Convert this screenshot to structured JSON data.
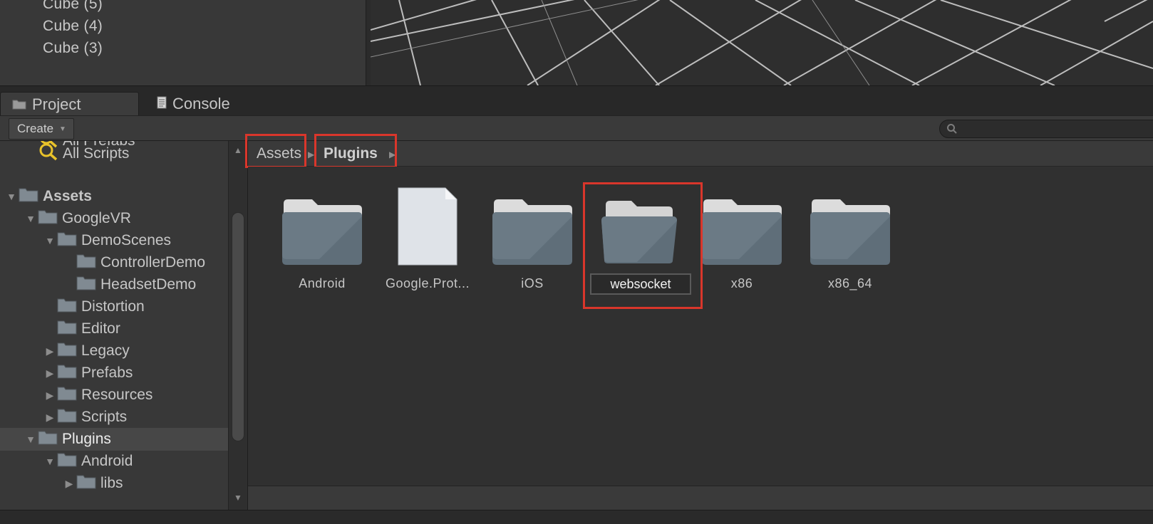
{
  "hierarchy": {
    "items": [
      "Cube (5)",
      "Cube (4)",
      "Cube (3)"
    ]
  },
  "tabs": {
    "project": "Project",
    "console": "Console"
  },
  "toolbar": {
    "create_label": "Create",
    "search_placeholder": ""
  },
  "tree": {
    "partial_item": "All Prefabs",
    "all_scripts": "All Scripts",
    "items": [
      {
        "label": "Assets",
        "expanded": true
      },
      {
        "label": "GoogleVR",
        "expanded": true
      },
      {
        "label": "DemoScenes",
        "expanded": true
      },
      {
        "label": "ControllerDemo"
      },
      {
        "label": "HeadsetDemo"
      },
      {
        "label": "Distortion"
      },
      {
        "label": "Editor"
      },
      {
        "label": "Legacy",
        "expanded": false
      },
      {
        "label": "Prefabs",
        "expanded": false
      },
      {
        "label": "Resources",
        "expanded": false
      },
      {
        "label": "Scripts",
        "expanded": false
      },
      {
        "label": "Plugins",
        "expanded": true,
        "selected": true
      },
      {
        "label": "Android",
        "expanded": true
      },
      {
        "label": "libs",
        "expanded": false
      }
    ]
  },
  "breadcrumb": {
    "items": [
      "Assets",
      "Plugins"
    ]
  },
  "assets": {
    "items": [
      {
        "name": "Android",
        "type": "folder"
      },
      {
        "name": "Google.Prot...",
        "type": "file"
      },
      {
        "name": "iOS",
        "type": "folder"
      },
      {
        "name": "websocket",
        "type": "folder",
        "renaming": true
      },
      {
        "name": "x86",
        "type": "folder"
      },
      {
        "name": "x86_64",
        "type": "folder"
      }
    ]
  },
  "colors": {
    "highlight_box": "#d9362b",
    "panel_bg": "#383838",
    "content_bg": "#303030",
    "search_icon": "#e8c22a"
  },
  "icons": {
    "project_tab": "folder-icon",
    "console_tab": "console-icon",
    "search": "search-icon",
    "saved_search": "magnifier-icon"
  }
}
